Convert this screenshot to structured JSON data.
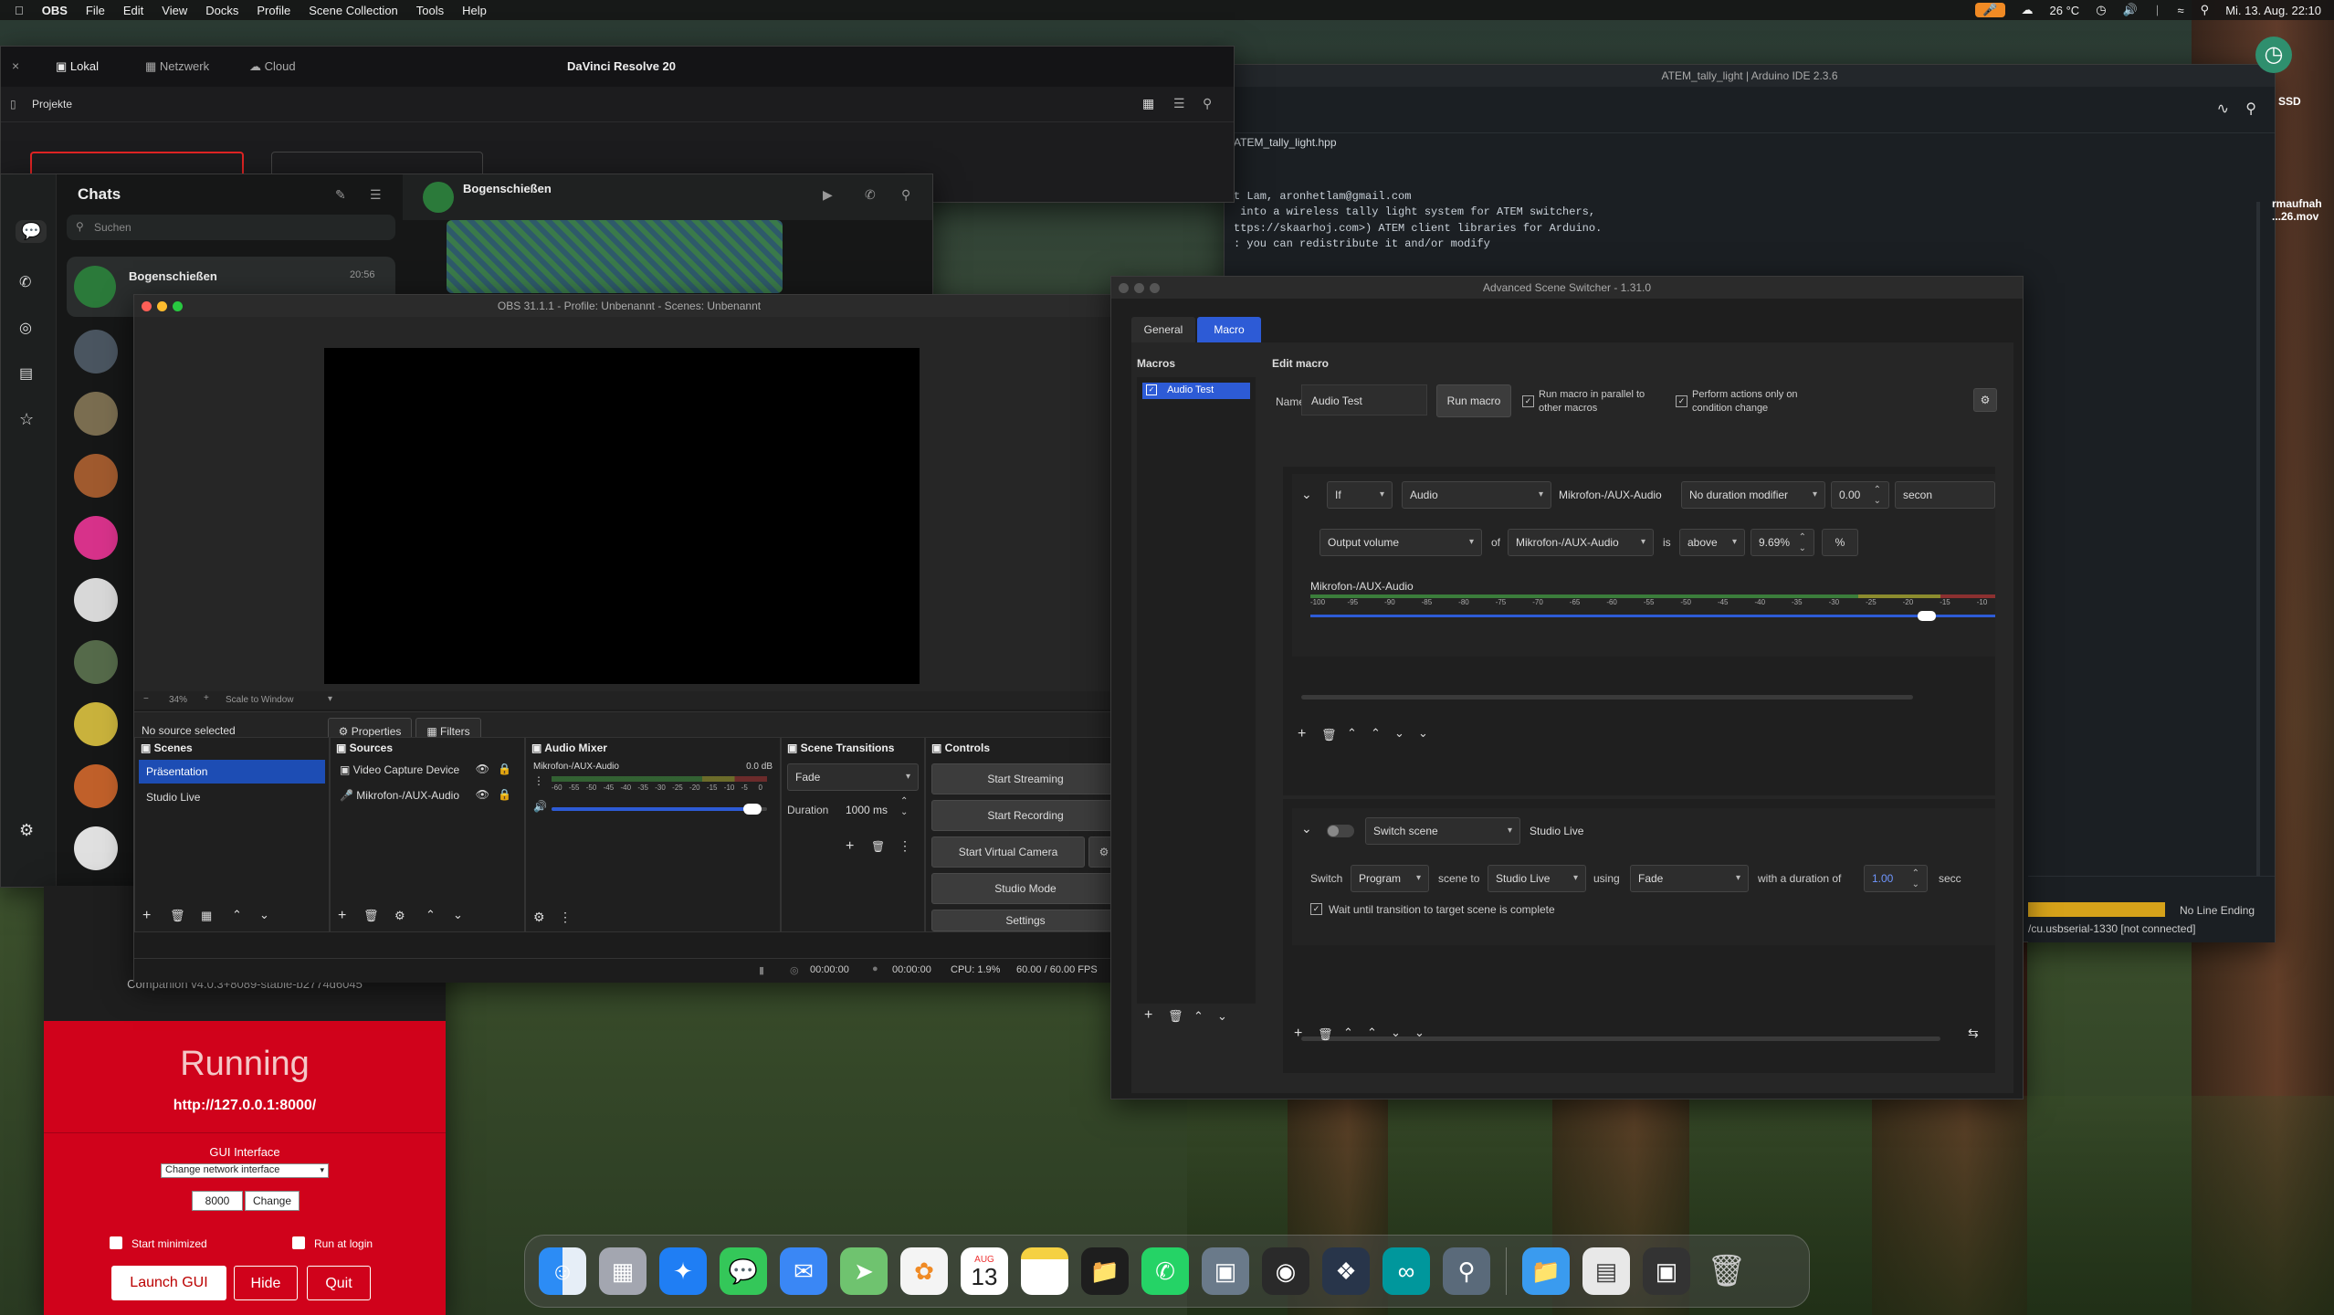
{
  "menubar": {
    "app": "OBS",
    "items": [
      "File",
      "Edit",
      "View",
      "Docks",
      "Profile",
      "Scene Collection",
      "Tools",
      "Help"
    ],
    "weather": "26 °C",
    "datetime": "Mi. 13. Aug.  22:10"
  },
  "resolve": {
    "tabs": [
      "Lokal",
      "Netzwerk",
      "Cloud"
    ],
    "title": "DaVinci Resolve 20",
    "projects": "Projekte"
  },
  "whatsapp": {
    "heading": "Chats",
    "search_placeholder": "Suchen",
    "first_chat_name": "Bogenschießen",
    "first_chat_time": "20:56",
    "header_name": "Bogenschießen"
  },
  "arduino": {
    "title": "ATEM_tally_light | Arduino IDE 2.3.6",
    "file": "ATEM_tally_light.hpp",
    "code": [
      "t Lam, aronhetlam@gmail.com",
      "",
      " into a wireless tally light system for ATEM switchers,",
      "ttps://skaarhoj.com>) ATEM client libraries for Arduino.",
      "",
      ": you can redistribute it and/or modify"
    ],
    "line_ending": "No Line Ending",
    "port": "/cu.usbserial-1330 [not connected]",
    "desk_ssd": "SSD",
    "desk_file": "rmaufnah\n...26.mov"
  },
  "obs": {
    "title": "OBS 31.1.1 - Profile: Unbenannt - Scenes: Unbenannt",
    "zoom": "34%",
    "scale": "Scale to Window",
    "no_source": "No source selected",
    "properties": "Properties",
    "filters": "Filters",
    "docks": {
      "scenes": "Scenes",
      "sources": "Sources",
      "mixer": "Audio Mixer",
      "transitions": "Scene Transitions",
      "controls": "Controls"
    },
    "scenes": [
      "Präsentation",
      "Studio Live"
    ],
    "sources": [
      "Video Capture Device",
      "Mikrofon-/AUX-Audio"
    ],
    "mixer_channel": "Mikrofon-/AUX-Audio",
    "mixer_db": "0.0 dB",
    "mixer_volume": 0.95,
    "mixer_ticks": [
      "-60",
      "-55",
      "-50",
      "-45",
      "-40",
      "-35",
      "-30",
      "-25",
      "-20",
      "-15",
      "-10",
      "-5",
      "0"
    ],
    "transition": "Fade",
    "duration_label": "Duration",
    "duration": "1000 ms",
    "controls": [
      "Start Streaming",
      "Start Recording",
      "Start Virtual Camera",
      "Studio Mode",
      "Settings"
    ],
    "status": {
      "time1": "00:00:00",
      "time2": "00:00:00",
      "cpu": "CPU: 1.9%",
      "fps": "60.00 / 60.00 FPS"
    }
  },
  "companion": {
    "version": "Companion v4.0.3+8089-stable-b2774d6045",
    "status": "Running",
    "url": "http://127.0.0.1:8000/",
    "gui_label": "GUI Interface",
    "interface": "Change network interface",
    "port": "8000",
    "change": "Change",
    "start_min": "Start minimized",
    "run_login": "Run at login",
    "launch": "Launch GUI",
    "hide": "Hide",
    "quit": "Quit"
  },
  "ass": {
    "title": "Advanced Scene Switcher - 1.31.0",
    "tabs": [
      "General",
      "Macro"
    ],
    "macros_heading": "Macros",
    "macro_item": "Audio Test",
    "edit_heading": "Edit macro",
    "name_label": "Name:",
    "name_value": "Audio Test",
    "run_macro": "Run macro",
    "parallel": "Run macro in parallel to other macros",
    "only_change": "Perform actions only on condition change",
    "cond": {
      "if": "If",
      "type": "Audio",
      "source": "Mikrofon-/AUX-Audio",
      "modifier": "No duration modifier",
      "dur": "0.00",
      "unit": "secon",
      "measure": "Output volume",
      "of": "of",
      "src2": "Mikrofon-/AUX-Audio",
      "is": "is",
      "cmp": "above",
      "value": "9.69%",
      "pct": "%",
      "meter_label": "Mikrofon-/AUX-Audio",
      "meter_ticks": [
        "-100",
        "-95",
        "-90",
        "-85",
        "-80",
        "-75",
        "-70",
        "-65",
        "-60",
        "-55",
        "-50",
        "-45",
        "-40",
        "-35",
        "-30",
        "-25",
        "-20",
        "-15",
        "-10"
      ],
      "threshold": 0.9
    },
    "action": {
      "type": "Switch scene",
      "scene": "Studio Live",
      "switch": "Switch",
      "target": "Program",
      "scene_to": "scene to",
      "scene_sel": "Studio Live",
      "using": "using",
      "trans": "Fade",
      "with": "with a duration of",
      "dur": "1.00",
      "unit": "secc",
      "wait": "Wait until transition to target scene is complete"
    }
  },
  "dock": {
    "calendar_month": "AUG",
    "calendar_day": "13"
  },
  "colors": {
    "accent": "#2d5bd6",
    "companion_red": "#d0021b"
  }
}
